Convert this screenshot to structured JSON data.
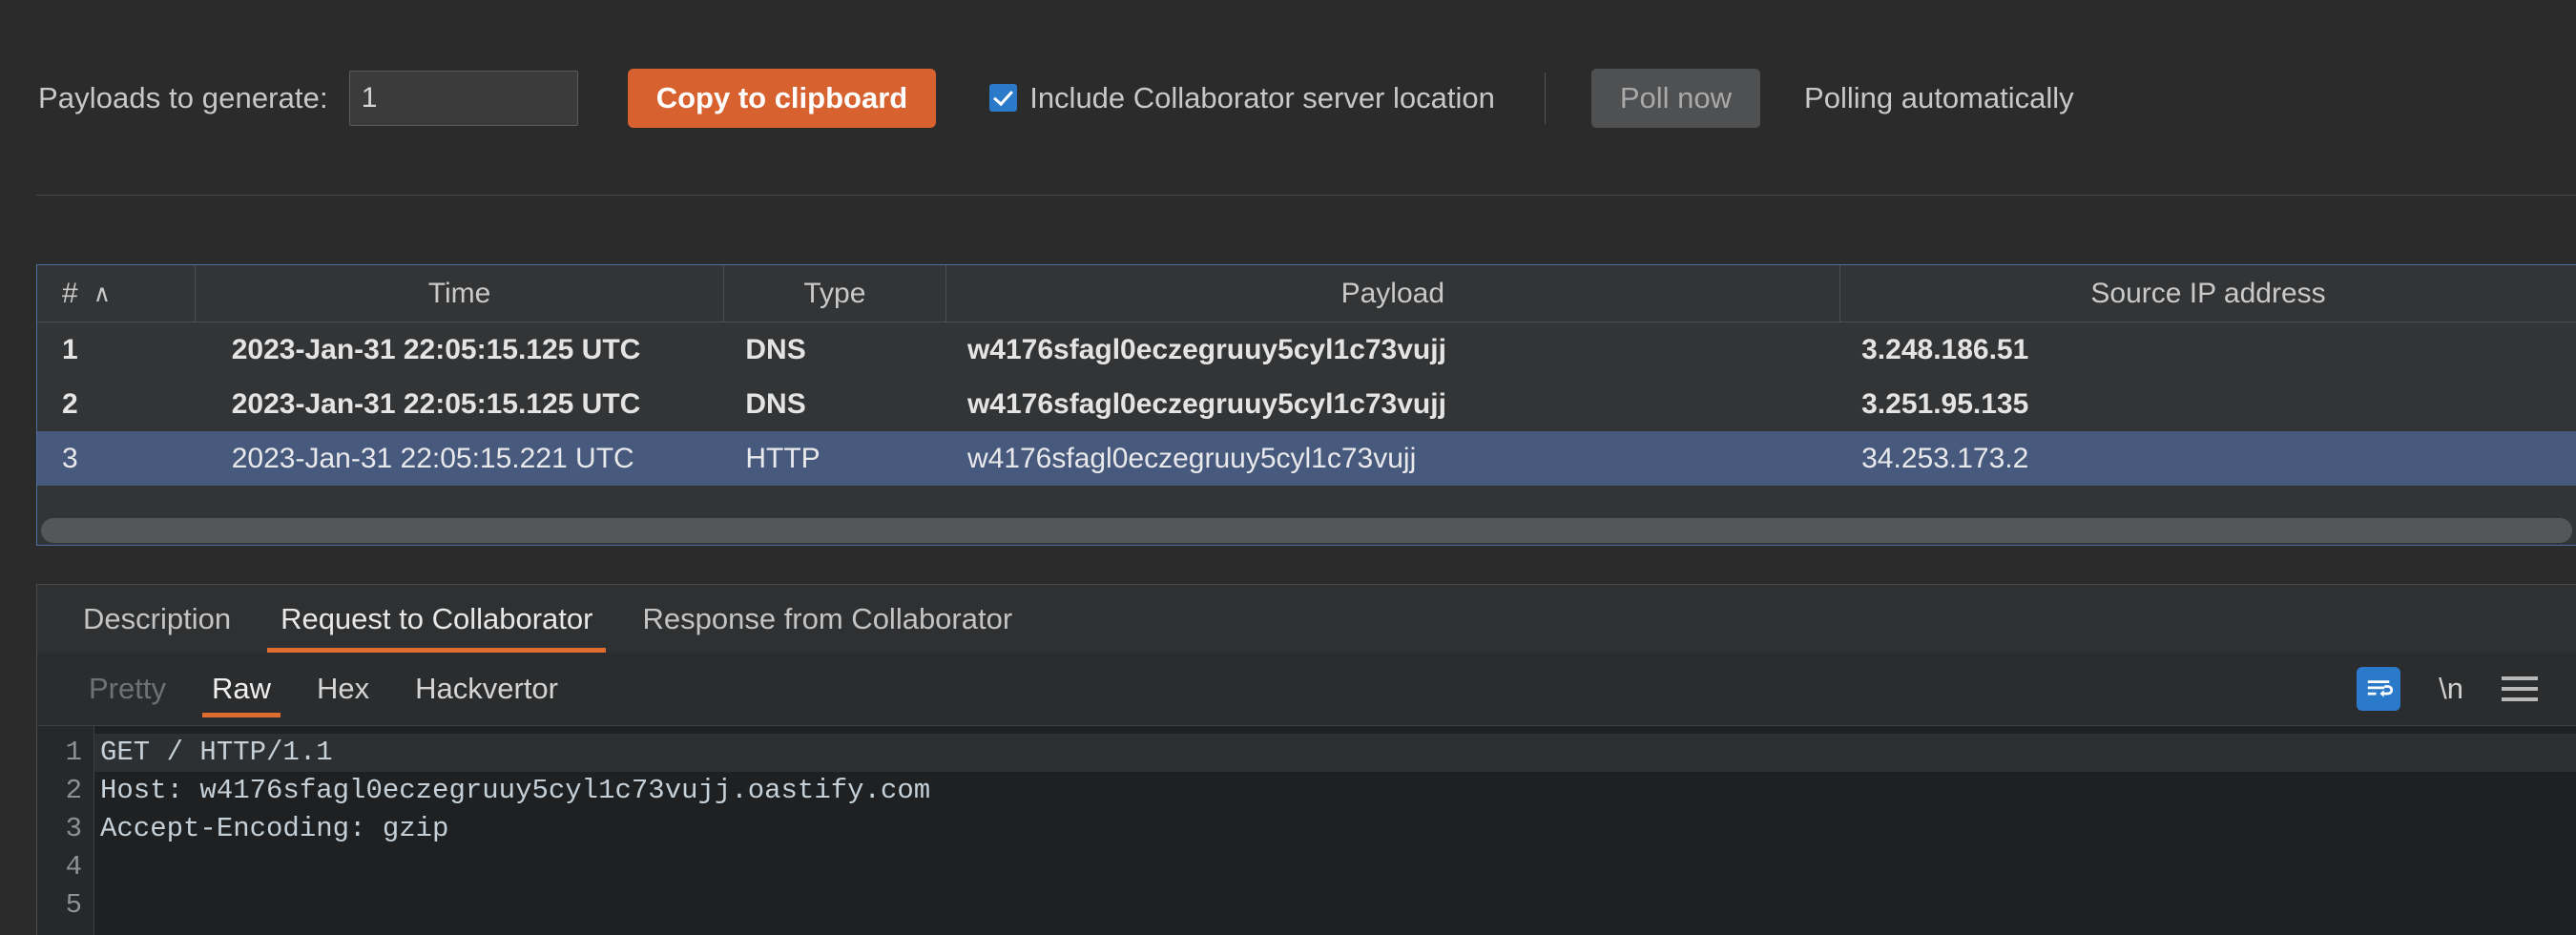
{
  "toolbar": {
    "payloads_label": "Payloads to generate:",
    "payloads_value": "1",
    "copy_button": "Copy to clipboard",
    "include_location_label": "Include Collaborator server location",
    "include_location_checked": true,
    "poll_now_button": "Poll now",
    "polling_status": "Polling automatically",
    "accent_color": "#d8622f",
    "checkbox_color": "#2b79c9"
  },
  "table": {
    "sort_column": "#",
    "sort_direction_glyph": "∧",
    "columns": [
      "#",
      "Time",
      "Type",
      "Payload",
      "Source IP address"
    ],
    "rows": [
      {
        "index": "1",
        "time": "2023-Jan-31 22:05:15.125 UTC",
        "type": "DNS",
        "payload": "w4176sfagl0eczegruuy5cyl1c73vujj",
        "source_ip": "3.248.186.51",
        "selected": false
      },
      {
        "index": "2",
        "time": "2023-Jan-31 22:05:15.125 UTC",
        "type": "DNS",
        "payload": "w4176sfagl0eczegruuy5cyl1c73vujj",
        "source_ip": "3.251.95.135",
        "selected": false
      },
      {
        "index": "3",
        "time": "2023-Jan-31 22:05:15.221 UTC",
        "type": "HTTP",
        "payload": "w4176sfagl0eczegruuy5cyl1c73vujj",
        "source_ip": "34.253.173.2",
        "selected": true
      }
    ],
    "selected_row_color": "#475a7d"
  },
  "detail_tabs": {
    "items": [
      "Description",
      "Request to Collaborator",
      "Response from Collaborator"
    ],
    "active": "Request to Collaborator",
    "active_underline_color": "#e06c2e"
  },
  "view_tabs": {
    "items": [
      "Pretty",
      "Raw",
      "Hex",
      "Hackvertor"
    ],
    "active": "Raw",
    "disabled": [
      "Pretty"
    ],
    "actions": {
      "word_wrap": "word-wrap-icon",
      "newline": "\\n",
      "menu": "hamburger-menu-icon"
    }
  },
  "editor": {
    "line_numbers": [
      "1",
      "2",
      "3",
      "4",
      "5"
    ],
    "lines": [
      "GET / HTTP/1.1",
      "Host: w4176sfagl0eczegruuy5cyl1c73vujj.oastify.com",
      "Accept-Encoding: gzip",
      "",
      ""
    ],
    "current_line": 1
  }
}
